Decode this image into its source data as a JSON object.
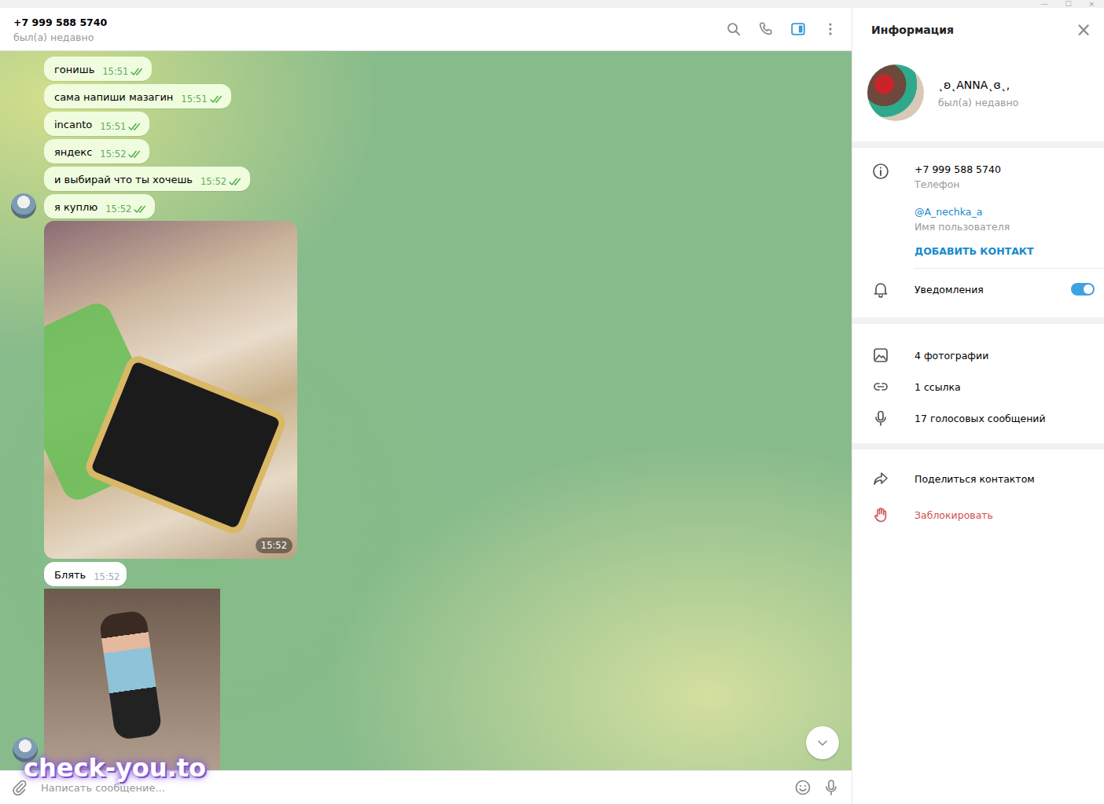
{
  "window": {
    "controls": [
      "—",
      "☐",
      "×"
    ]
  },
  "header": {
    "title": "+7 999 588 5740",
    "status": "был(а) недавно",
    "sidebar_toggle_on": true
  },
  "messages": [
    {
      "kind": "text",
      "text": "гонишь",
      "time": "15:51",
      "outgoing": true,
      "read": true,
      "avatar": false
    },
    {
      "kind": "text",
      "text": "сама напиши мазагин",
      "time": "15:51",
      "outgoing": true,
      "read": true,
      "avatar": false
    },
    {
      "kind": "text",
      "text": "incanto",
      "time": "15:51",
      "outgoing": true,
      "read": true,
      "avatar": false
    },
    {
      "kind": "text",
      "text": "яндекс",
      "time": "15:52",
      "outgoing": true,
      "read": true,
      "avatar": false
    },
    {
      "kind": "text",
      "text": "и выбирай что ты хочешь",
      "time": "15:52",
      "outgoing": true,
      "read": true,
      "avatar": false
    },
    {
      "kind": "text",
      "text": "я куплю",
      "time": "15:52",
      "outgoing": true,
      "read": true,
      "avatar": true
    },
    {
      "kind": "photo",
      "time": "15:52",
      "avatar": false
    },
    {
      "kind": "text",
      "text": "Блять",
      "time": "15:52",
      "outgoing": false,
      "read": false,
      "avatar": false
    },
    {
      "kind": "video",
      "avatar": true
    }
  ],
  "composer": {
    "placeholder": "Написать сообщение..."
  },
  "watermark": "check-you.to",
  "info_panel": {
    "title": "Информация",
    "close": "×",
    "name": "˛ʚ˛ANNA˛ɞ˛,",
    "status": "был(а) недавно",
    "phone": {
      "value": "+7 999 588 5740",
      "label": "Телефон"
    },
    "username": {
      "value": "@A_nechka_a",
      "label": "Имя пользователя"
    },
    "add_contact": "ДОБАВИТЬ КОНТАКТ",
    "notifications": {
      "label": "Уведомления",
      "on": true
    },
    "media": [
      {
        "label": "4 фотографии",
        "kind": "photos"
      },
      {
        "label": "1 ссылка",
        "kind": "links"
      },
      {
        "label": "17 голосовых сообщений",
        "kind": "voice"
      }
    ],
    "actions": [
      {
        "label": "Поделиться контактом",
        "kind": "share"
      },
      {
        "label": "Заблокировать",
        "kind": "block"
      }
    ]
  }
}
